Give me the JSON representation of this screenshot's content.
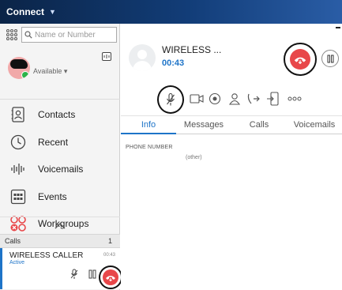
{
  "window": {
    "title": "Connect"
  },
  "search": {
    "placeholder": "Name or Number",
    "value": ""
  },
  "user": {
    "presence": "Available ▾"
  },
  "nav": [
    {
      "id": "contacts",
      "label": "Contacts",
      "icon": "contacts-icon"
    },
    {
      "id": "recent",
      "label": "Recent",
      "icon": "clock-icon"
    },
    {
      "id": "voicemails",
      "label": "Voicemails",
      "icon": "voicemail-wave-icon"
    },
    {
      "id": "events",
      "label": "Events",
      "icon": "events-grid-icon"
    },
    {
      "id": "workgroups",
      "label": "Workgroups",
      "icon": "workgroups-icon"
    }
  ],
  "calls_panel": {
    "header": "Calls",
    "count": "1",
    "call": {
      "name": "WIRELESS CALLER",
      "status": "Active",
      "time": "00:43"
    }
  },
  "active_call": {
    "name": "WIRELESS ...",
    "timer": "00:43"
  },
  "tabs": [
    {
      "label": "Info",
      "active": true
    },
    {
      "label": "Messages",
      "active": false
    },
    {
      "label": "Calls",
      "active": false
    },
    {
      "label": "Voicemails",
      "active": false
    }
  ],
  "info": {
    "phone_number_label": "PHONE NUMBER",
    "phone_type": "(other)"
  },
  "colors": {
    "accent": "#1e74c8",
    "hangup": "#e8474a",
    "presence_available": "#2db34a",
    "titlebar": "#0b2447"
  }
}
